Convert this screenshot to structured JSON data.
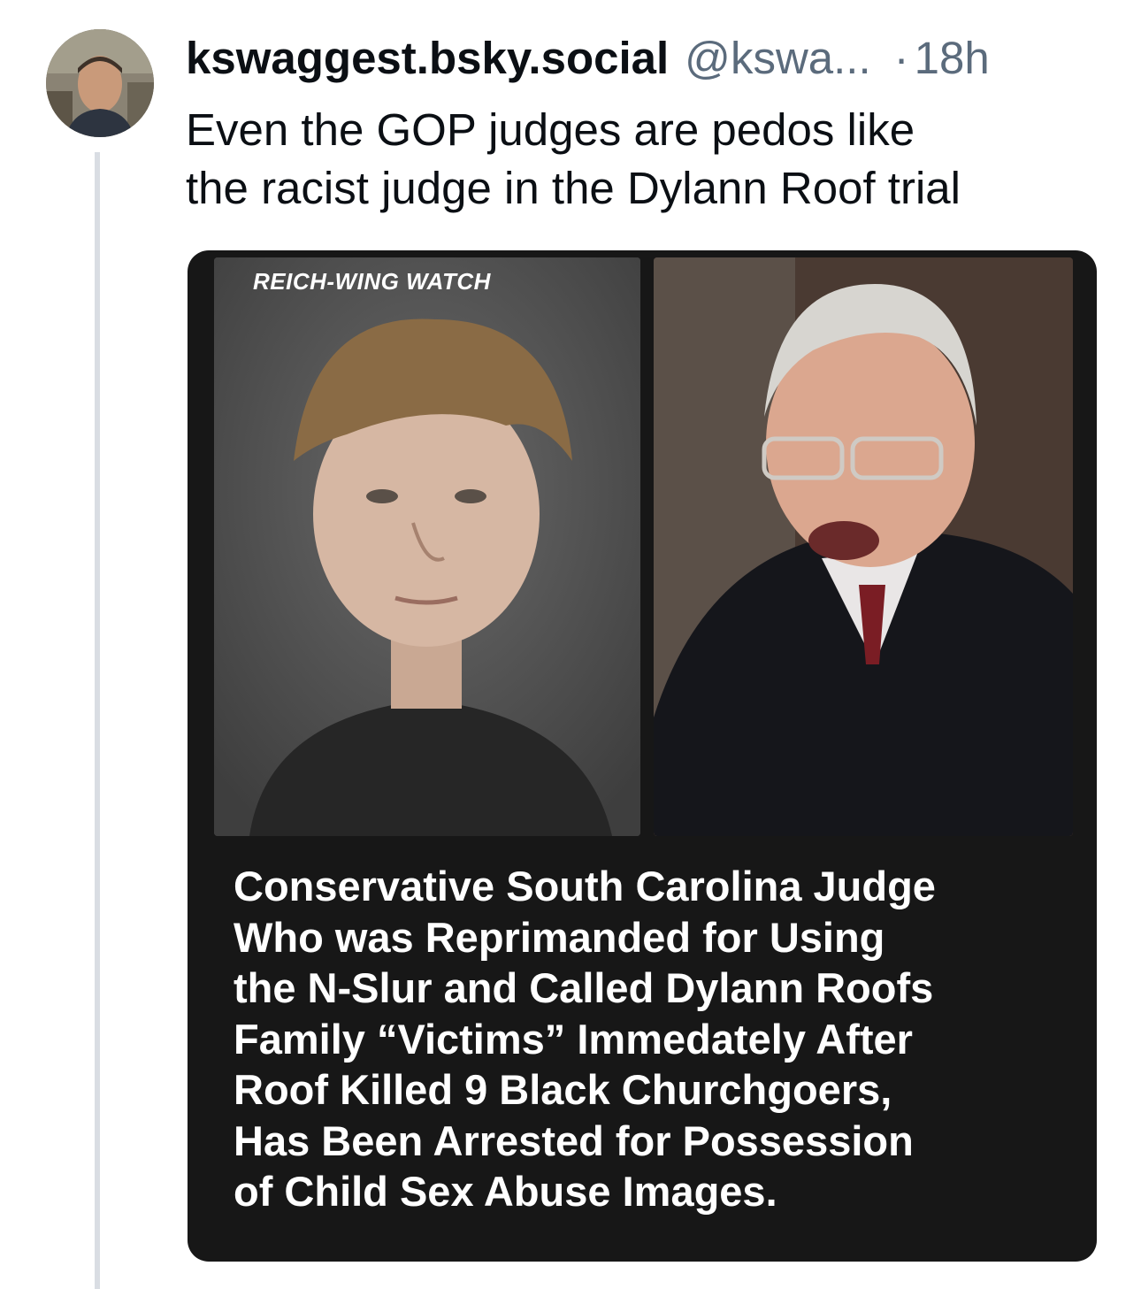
{
  "post": {
    "display_name": "kswaggest.bsky.social",
    "handle": "@kswa...",
    "separator": "·",
    "time": "18h",
    "text_lines": [
      "Even the GOP judges are pedos like",
      "the racist judge in the Dylann Roof trial"
    ]
  },
  "embed": {
    "watermark": "REICH-WING WATCH",
    "headline_lines": [
      "Conservative South Carolina Judge",
      "Who was Reprimanded for Using",
      "the N-Slur and Called Dylann Roofs",
      "Family “Victims” Immedately After",
      "Roof Killed 9 Black Churchgoers,",
      "Has Been Arrested for Possession",
      "of Child Sex Abuse Images."
    ]
  },
  "colors": {
    "secondary_text": "#5b6b7c",
    "embed_background": "#171717",
    "thread_line": "#d9dde3"
  }
}
